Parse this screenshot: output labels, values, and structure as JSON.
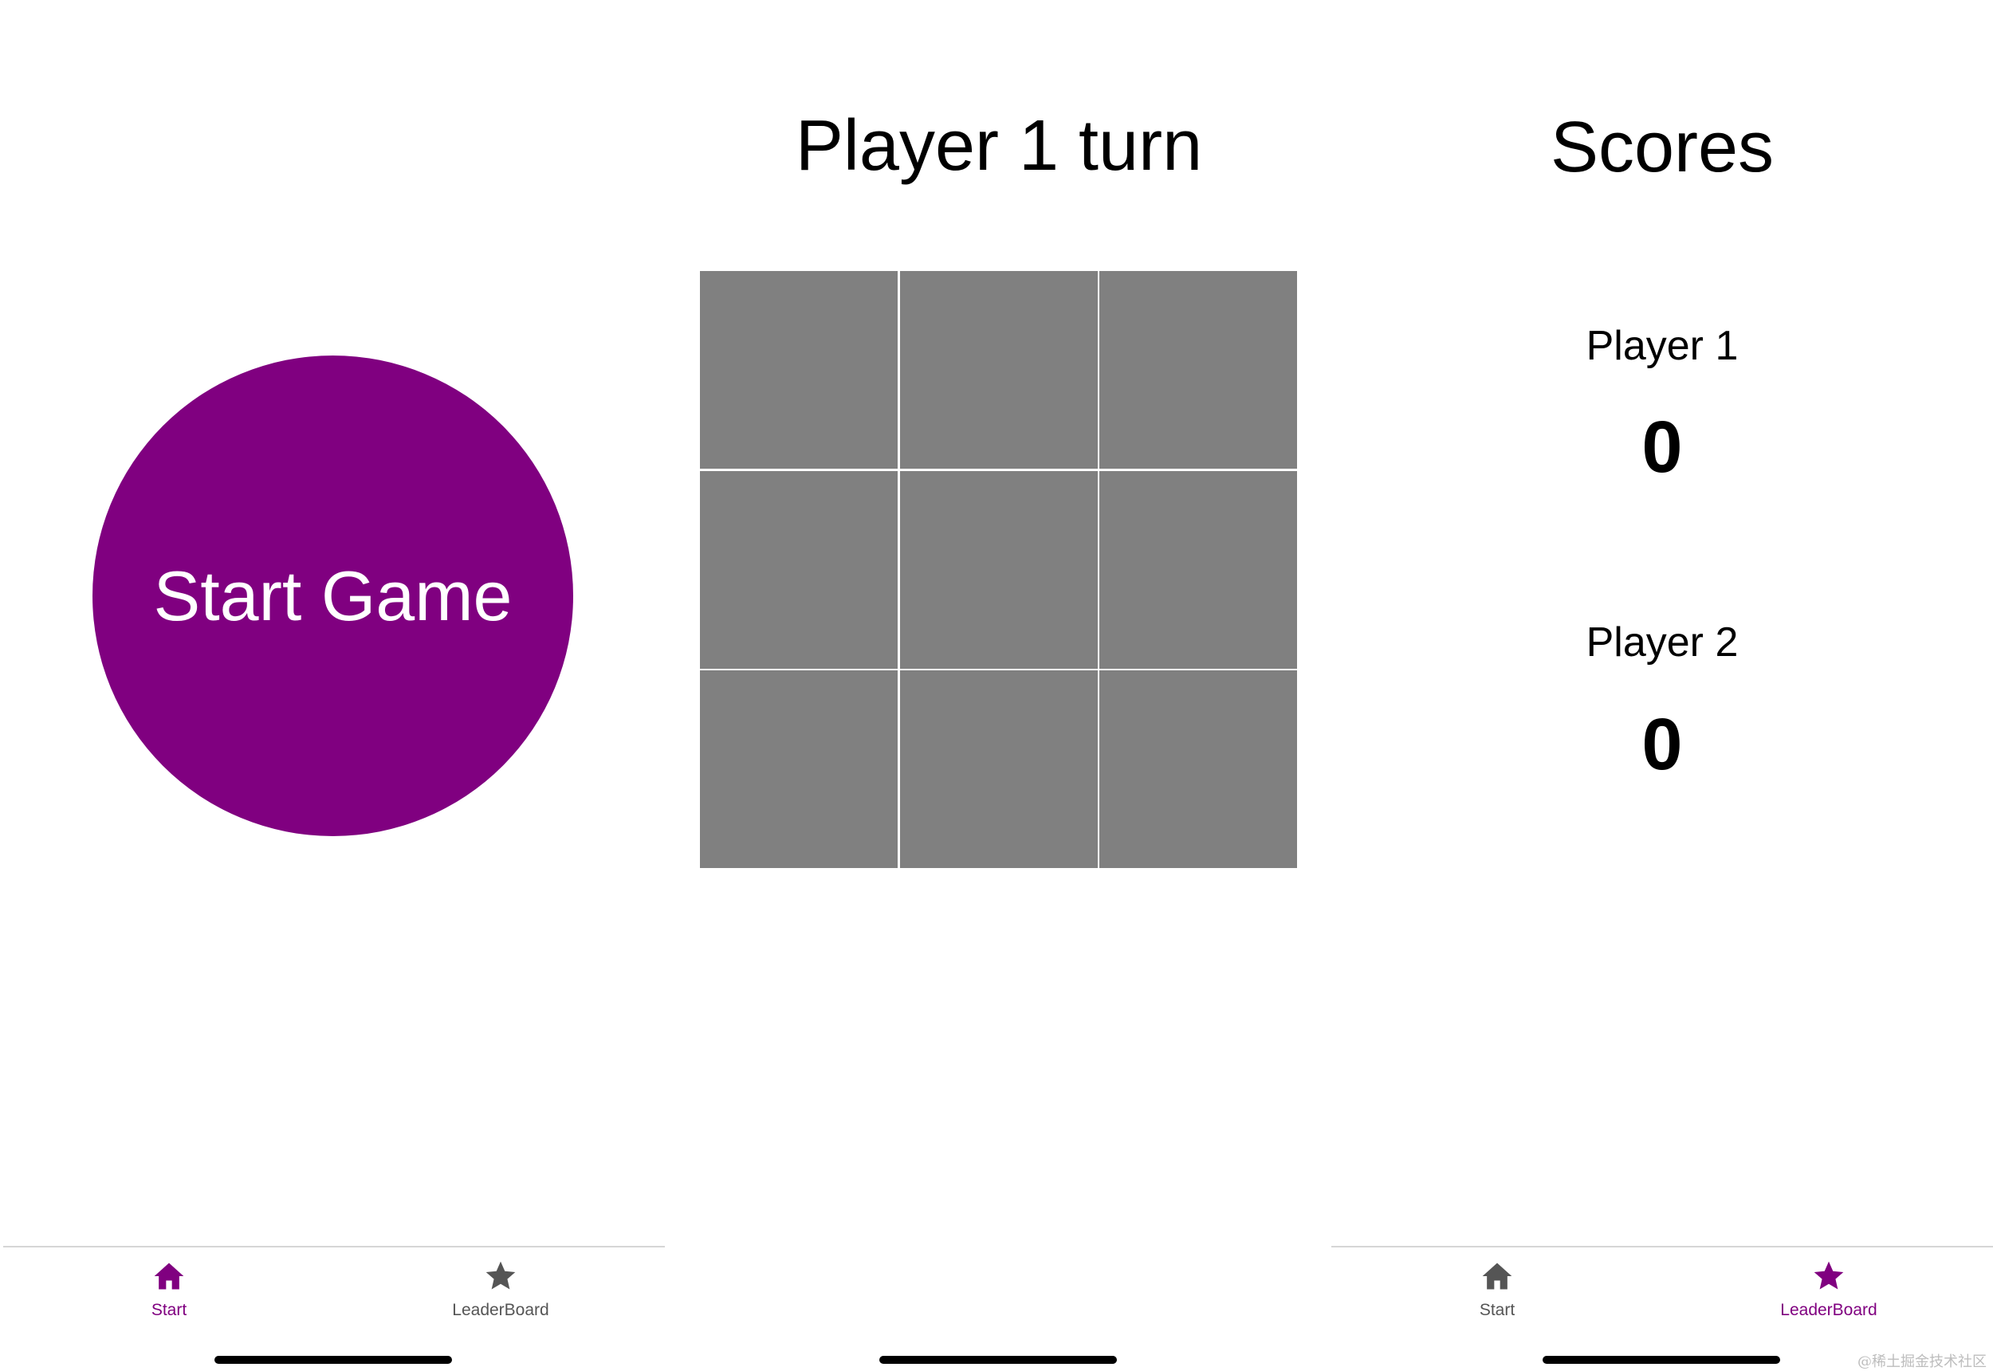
{
  "colors": {
    "accent": "#800080",
    "cell": "#808080",
    "tab_inactive": "#555555"
  },
  "start_screen": {
    "button_label": "Start Game",
    "tabs": [
      {
        "label": "Start",
        "icon": "home-icon",
        "active": true
      },
      {
        "label": "LeaderBoard",
        "icon": "star-icon",
        "active": false
      }
    ]
  },
  "game_screen": {
    "turn_title": "Player 1 turn",
    "board": [
      "",
      "",
      "",
      "",
      "",
      "",
      "",
      "",
      ""
    ]
  },
  "scores_screen": {
    "title": "Scores",
    "player1": {
      "label": "Player 1",
      "score": "0"
    },
    "player2": {
      "label": "Player 2",
      "score": "0"
    },
    "tabs": [
      {
        "label": "Start",
        "icon": "home-icon",
        "active": false
      },
      {
        "label": "LeaderBoard",
        "icon": "star-icon",
        "active": true
      }
    ]
  },
  "watermark": "@稀土掘金技术社区"
}
